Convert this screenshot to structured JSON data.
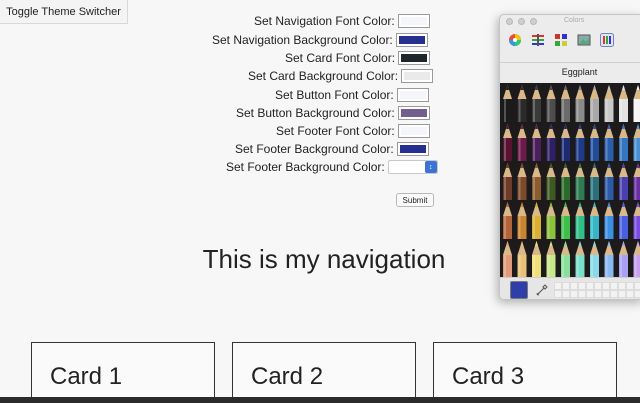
{
  "toggle_button": {
    "label": "Toggle Theme Switcher"
  },
  "form": {
    "rows": [
      {
        "label": "Set Navigation Font Color:",
        "control": "swatch",
        "color": "#f4f6fb"
      },
      {
        "label": "Set Navigation Background Color:",
        "control": "swatch",
        "color": "#262f8f"
      },
      {
        "label": "Set Card Font Color:",
        "control": "swatch",
        "color": "#1d262d"
      },
      {
        "label": "Set Card Background Color:",
        "control": "swatch",
        "color": "#eaeaea"
      },
      {
        "label": "Set Button Font Color:",
        "control": "swatch",
        "color": "#f4f6fb"
      },
      {
        "label": "Set Button Background Color:",
        "control": "swatch",
        "color": "#735f8f"
      },
      {
        "label": "Set Footer Font Color:",
        "control": "swatch",
        "color": "#f4f6fb"
      },
      {
        "label": "Set Footer Background Color:",
        "control": "swatch",
        "color": "#262f8f"
      },
      {
        "label": "Set Footer Background Color:",
        "control": "select",
        "value": ""
      }
    ],
    "submit_label": "Submit"
  },
  "navigation": {
    "title": "This is my navigation"
  },
  "cards": [
    {
      "title": "Card 1"
    },
    {
      "title": "Card 2"
    },
    {
      "title": "Card 3"
    }
  ],
  "colors_panel": {
    "title": "Colors",
    "selected_color_name": "Eggplant",
    "current_color": "#2f3ea8",
    "tools": [
      "color-wheel-icon",
      "color-sliders-icon",
      "color-palettes-icon",
      "image-palettes-icon",
      "crayons-icon"
    ],
    "pencil_colors": [
      [
        "#1b1b1b",
        "#2a2a2a",
        "#3a3a3a",
        "#4d4d4d",
        "#6a6a6a",
        "#8a8a8a",
        "#a8a8a8",
        "#c8c8c8",
        "#e3e3e3",
        "#f4f4f4"
      ],
      [
        "#5a1230",
        "#6b1a4a",
        "#4b1f5c",
        "#2e1f66",
        "#1d2b73",
        "#1e3b8a",
        "#204c9a",
        "#2a5fae",
        "#3575c0",
        "#4b90d4"
      ],
      [
        "#6e3a2a",
        "#7a4a2b",
        "#8a5c2f",
        "#3e5a22",
        "#2c6a2a",
        "#2d7c52",
        "#2a6f7a",
        "#2b5aa8",
        "#4a3fae",
        "#6a2fa0"
      ],
      [
        "#b5643a",
        "#c9842f",
        "#d9b030",
        "#8bc23a",
        "#3fbf4a",
        "#2fbf8a",
        "#35b5c5",
        "#3b8ee0",
        "#4a5fe0",
        "#7a4ce0"
      ],
      [
        "#e09a7a",
        "#e8c07a",
        "#f0e07a",
        "#c8e88a",
        "#8ae09a",
        "#7ae0c8",
        "#8ad8e8",
        "#8ab8f0",
        "#a8a0f0",
        "#c8a0f0"
      ]
    ]
  }
}
